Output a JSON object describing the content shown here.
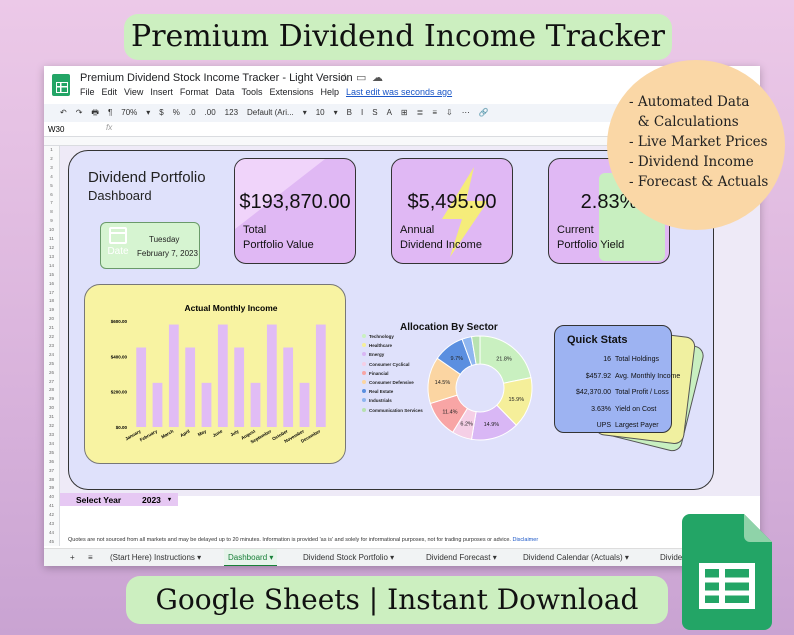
{
  "promo": {
    "title": "Premium Dividend Income Tracker",
    "footer": "Google Sheets  | Instant Download",
    "features": [
      "- Automated Data",
      "  & Calculations",
      "- Live Market Prices",
      "- Dividend Income",
      "- Forecast & Actuals"
    ]
  },
  "app": {
    "doc_title": "Premium Dividend Stock Income Tracker - Light Version",
    "menus": [
      "File",
      "Edit",
      "View",
      "Insert",
      "Format",
      "Data",
      "Tools",
      "Extensions",
      "Help"
    ],
    "last_edit": "Last edit was seconds ago",
    "cell_ref": "W30",
    "fx": "fx",
    "toolbar": [
      "↶",
      "↷",
      "🖶",
      "¶",
      "70%",
      "▾",
      "$",
      "%",
      ".0",
      ".00",
      "123",
      "Default (Ari...",
      "▾",
      "10",
      "▾",
      "B",
      "I",
      "S",
      "A",
      "⊞",
      "≣",
      "≡",
      "⇩",
      "⋯",
      "🔗"
    ]
  },
  "dashboard": {
    "title_line1": "Dividend Portfolio",
    "title_line2": "Dashboard",
    "date_icon_label": "Date",
    "date_day": "Tuesday",
    "date_full": "February 7, 2023",
    "cards": [
      {
        "value": "$193,870.00",
        "label1": "Total",
        "label2": "Portfolio Value"
      },
      {
        "value": "$5,495.00",
        "label1": "Annual",
        "label2": "Dividend Income"
      },
      {
        "value": "2.83%",
        "label1": "Current",
        "label2": "Portfolio Yield"
      }
    ],
    "select_year_label": "Select Year",
    "select_year_value": "2023"
  },
  "quick_stats": {
    "title": "Quick Stats",
    "rows": [
      {
        "value": "16",
        "label": "Total Holdings"
      },
      {
        "value": "$457.92",
        "label": "Avg. Monthly Income"
      },
      {
        "value": "$42,370.00",
        "label": "Total Profit / Loss"
      },
      {
        "value": "3.63%",
        "label": "Yield on Cost"
      },
      {
        "value": "UPS",
        "label": "Largest Payer"
      }
    ]
  },
  "sector": {
    "title": "Allocation By Sector"
  },
  "disclaimer": {
    "text": "Quotes are not sourced from all markets and may be delayed up to 20 minutes. Information is provided 'as is' and solely for informational purposes, not for trading purposes or advice.",
    "link": "Disclaimer"
  },
  "tabs": [
    "+",
    "≡",
    "(Start Here) Instructions ▾",
    "Dashboard ▾",
    "Dividend Stock Portfolio ▾",
    "Dividend Forecast ▾",
    "Dividend Calendar (Actuals) ▾",
    "Divide"
  ],
  "colors": {
    "purple_card": "#e0b8f4",
    "chart_bg": "#f8f3a2",
    "bar": "#e1bcf5",
    "stats": "#9db3f2",
    "sheets_green": "#23a566"
  },
  "chart_data": [
    {
      "type": "bar",
      "title": "Actual Monthly Income",
      "categories": [
        "January",
        "February",
        "March",
        "April",
        "May",
        "June",
        "July",
        "August",
        "September",
        "October",
        "November",
        "December"
      ],
      "series": [
        {
          "values": [
            450,
            250,
            580,
            450,
            250,
            580,
            450,
            250,
            580,
            450,
            250,
            580
          ]
        }
      ],
      "ylim": [
        0,
        600
      ],
      "yticks": [
        "$0.00",
        "$200.00",
        "$400.00",
        "$600.00"
      ],
      "grid": false
    },
    {
      "type": "pie",
      "title": "Allocation By Sector",
      "categories": [
        "Technology",
        "Healthcare",
        "Energy",
        "Consumer Cyclical",
        "Financial",
        "Consumer Defensive",
        "Real Estate",
        "Industrials",
        "Communication Services"
      ],
      "values": [
        21.8,
        15.9,
        14.9,
        6.2,
        11.4,
        14.5,
        9.7,
        3.0,
        2.6
      ],
      "labels": [
        "21.8%",
        "15.9%",
        "14.9%",
        "6.2%",
        "11.4%",
        "14.5%",
        "9.7%",
        "",
        ""
      ],
      "colors": [
        "#c9f0c0",
        "#f5ef9a",
        "#d9b7f5",
        "#f5cfe6",
        "#f8a5a5",
        "#fbd5a2",
        "#5b8fe0",
        "#8fb6f0",
        "#b8e2b0"
      ],
      "legend": "left"
    }
  ]
}
